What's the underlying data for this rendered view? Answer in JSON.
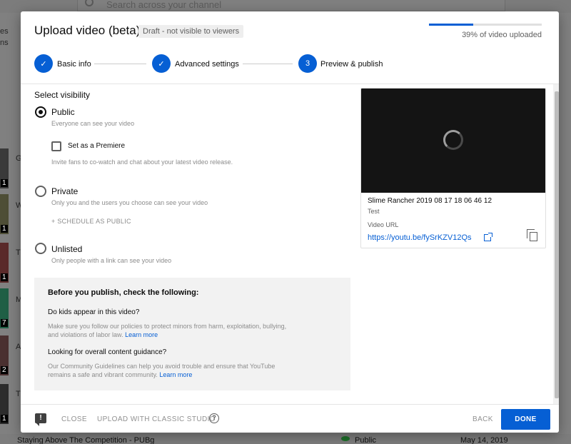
{
  "background": {
    "search_placeholder": "Search across your channel",
    "left_fragment_1": "es",
    "left_fragment_2": "ns",
    "thumb_numbers": [
      "1",
      "1",
      "1",
      "7",
      "2",
      "1"
    ],
    "row_letters": [
      "G",
      "W",
      "T",
      "M",
      "A",
      "T"
    ],
    "bottom_row": {
      "title": "Staying Above The Competition - PUBg",
      "visibility": "Public",
      "date": "May 14, 2019"
    }
  },
  "dialog": {
    "title": "Upload video (beta)",
    "draft_badge": "Draft - not visible to viewers",
    "progress_text": "39% of video uploaded",
    "progress_fraction": 0.39
  },
  "steps": [
    {
      "label": "Basic info",
      "marker": "✓"
    },
    {
      "label": "Advanced settings",
      "marker": "✓"
    },
    {
      "label": "Preview & publish",
      "marker": "3"
    }
  ],
  "visibility": {
    "title": "Select visibility",
    "public": {
      "label": "Public",
      "desc": "Everyone can see your video",
      "selected": true
    },
    "premiere": {
      "label": "Set as a Premiere",
      "desc": "Invite fans to co-watch and chat about your latest video release."
    },
    "private": {
      "label": "Private",
      "desc": "Only you and the users you choose can see your video"
    },
    "schedule": "+ SCHEDULE AS PUBLIC",
    "unlisted": {
      "label": "Unlisted",
      "desc": "Only people with a link can see your video"
    }
  },
  "checklist": {
    "heading": "Before you publish, check the following:",
    "q1": "Do kids appear in this video?",
    "p1": "Make sure you follow our policies to protect minors from harm, exploitation, bullying, and violations of labor law. ",
    "p1_link": "Learn more",
    "q2": "Looking for overall content guidance?",
    "p2": "Our Community Guidelines can help you avoid trouble and ensure that YouTube remains a safe and vibrant community. ",
    "p2_link": "Learn more"
  },
  "preview": {
    "video_title": "Slime Rancher 2019 08 17 18 06 46 12",
    "subtitle": "Test",
    "url_label": "Video URL",
    "url": "https://youtu.be/fySrKZV12Qs"
  },
  "footer": {
    "feedback_icon": "!",
    "close": "CLOSE",
    "classic": "UPLOAD WITH CLASSIC STUDIO",
    "help_icon": "?",
    "back": "BACK",
    "done": "DONE"
  },
  "colors": {
    "accent": "#065fd4",
    "overlay": "#808080"
  }
}
